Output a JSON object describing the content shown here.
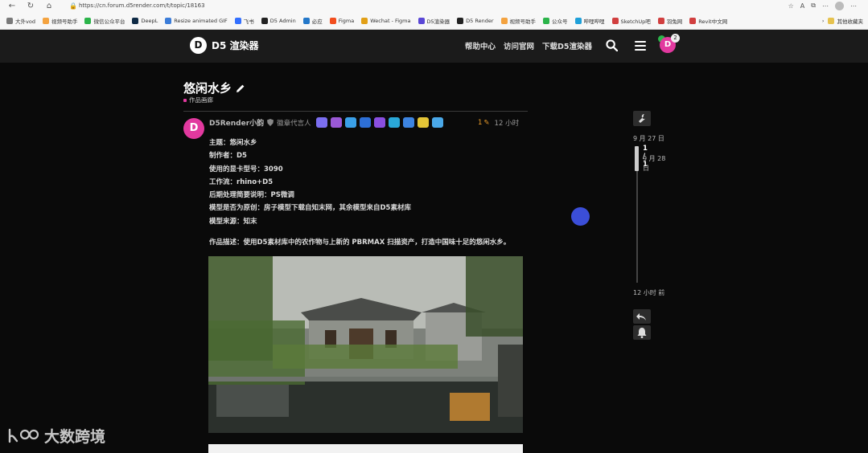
{
  "browser": {
    "url": "https://cn.forum.d5render.com/t/topic/18163",
    "bookmarks": [
      {
        "label": "大外vod",
        "color": "#7a7a7a"
      },
      {
        "label": "视频号助手",
        "color": "#f4a340"
      },
      {
        "label": "微信公众平台",
        "color": "#2bb44a"
      },
      {
        "label": "DeepL",
        "color": "#0f2b46"
      },
      {
        "label": "Resize animated GIF",
        "color": "#3c7dd9"
      },
      {
        "label": "飞书",
        "color": "#3370ff"
      },
      {
        "label": "D5 Admin",
        "color": "#222222"
      },
      {
        "label": "必应",
        "color": "#2478c9"
      },
      {
        "label": "Figma",
        "color": "#f24e1e"
      },
      {
        "label": "Wechat - Figma",
        "color": "#e2a017"
      },
      {
        "label": "D5渲染器",
        "color": "#5a47d6"
      },
      {
        "label": "D5 Render",
        "color": "#222222"
      },
      {
        "label": "视频号助手",
        "color": "#f4a340"
      },
      {
        "label": "公众号",
        "color": "#2bb44a"
      },
      {
        "label": "哔哩哔哩",
        "color": "#1fa0d9"
      },
      {
        "label": "SketchUp吧",
        "color": "#d13f3f"
      },
      {
        "label": "羽兔网",
        "color": "#d13f3f"
      },
      {
        "label": "Revit中文网",
        "color": "#d13f3f"
      }
    ],
    "bookmarks_more": "其他收藏夹"
  },
  "header": {
    "logo_mark": "D",
    "logo_text": "D5 渲染器",
    "links": [
      "帮助中心",
      "访问官网",
      "下载D5渲染器"
    ],
    "avatar_letter": "D",
    "notification_count": "2"
  },
  "topic": {
    "title": "悠闲水乡",
    "category": "作品画廊"
  },
  "post": {
    "avatar_letter": "D",
    "username": "D5Render小韵",
    "user_title": "徽章代言人",
    "edit_count": "1",
    "time": "12 小时",
    "lines": [
      "主题：悠闲水乡",
      "制作者：D5",
      "使用的显卡型号：3090",
      "工作流：rhino+D5",
      "后期处理简要说明：PS微调",
      "模型是否为原创：房子模型下载自知末网，其余模型来自D5素材库",
      "模型来源：知末"
    ],
    "description": "作品描述：使用D5素材库中的农作物与上新的 PBRMAX 扫描资产，打造中国味十足的悠闲水乡。",
    "badges": [
      "#7b6ef0",
      "#9b59d6",
      "#3aa0e8",
      "#2d6fd6",
      "#8a4fe0",
      "#2aa8d8",
      "#3d84e0",
      "#e3c437",
      "#4aa8e8"
    ]
  },
  "timeline": {
    "start_date": "9 月 27 日",
    "position": "1 / 1",
    "current_date": "9 月 28 日",
    "end_label": "12 小时 前"
  },
  "watermark": {
    "text": "大数跨境"
  }
}
